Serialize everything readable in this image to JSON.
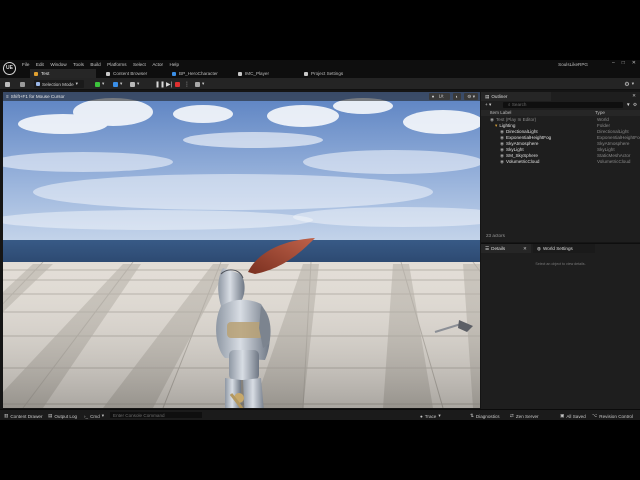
{
  "menubar": {
    "logo": "UE",
    "items": [
      "File",
      "Edit",
      "Window",
      "Tools",
      "Build",
      "Platforms",
      "Select",
      "Actor",
      "Help"
    ],
    "project_name": "SoulsLikeRPG"
  },
  "tabs": [
    {
      "label": "Test",
      "active": true,
      "color": "#e0a030"
    },
    {
      "label": "Content Browser",
      "active": false,
      "color": "#c8c8c8"
    },
    {
      "label": "BP_HeroCharacter",
      "active": false,
      "color": "#3a8ee6"
    },
    {
      "label": "IMC_Player",
      "active": false,
      "color": "#c8c8c8"
    },
    {
      "label": "Project Settings",
      "active": false,
      "color": "#c8c8c8"
    }
  ],
  "toolbar": {
    "selection_mode": "Selection Mode"
  },
  "viewport": {
    "label": "Shift+F1 for Mouse Cursor",
    "view_mode": "Lit"
  },
  "outliner": {
    "title": "Outliner",
    "search_placeholder": "Search",
    "col_label": "Item Label",
    "col_type": "Type",
    "rows": [
      {
        "label": "Test (Play In Editor)",
        "type": "World",
        "indent": 0,
        "dim": true
      },
      {
        "label": "Lighting",
        "type": "Folder",
        "indent": 1,
        "dim": false,
        "folder": true
      },
      {
        "label": "DirectionalLight",
        "type": "DirectionalLight",
        "indent": 2,
        "dim": false
      },
      {
        "label": "ExponentialHeightFog",
        "type": "ExponentialHeightFog",
        "indent": 2,
        "dim": false
      },
      {
        "label": "SkyAtmosphere",
        "type": "SkyAtmosphere",
        "indent": 2,
        "dim": false
      },
      {
        "label": "SkyLight",
        "type": "SkyLight",
        "indent": 2,
        "dim": false
      },
      {
        "label": "SM_SkySphere",
        "type": "StaticMeshActor",
        "indent": 2,
        "dim": false
      },
      {
        "label": "VolumetricCloud",
        "type": "VolumetricCloud",
        "indent": 2,
        "dim": false
      }
    ],
    "actor_count": "23 actors"
  },
  "details": {
    "tab_details": "Details",
    "tab_world_settings": "World Settings",
    "empty_message": "Select an object to view details."
  },
  "statusbar": {
    "content_drawer": "Content Drawer",
    "output_log": "Output Log",
    "cmd": "Cmd",
    "console_placeholder": "Enter Console Command",
    "trace": "Trace",
    "derived_data": "Diagnostics",
    "zen_server": "Zen Server",
    "all_saved": "All Saved",
    "revision_control": "Revision Control"
  },
  "colors": {
    "accent_blue": "#3a8ee6",
    "play_green": "#3cc33c",
    "stop_red": "#e03030",
    "folder_orange": "#d8a23a"
  }
}
